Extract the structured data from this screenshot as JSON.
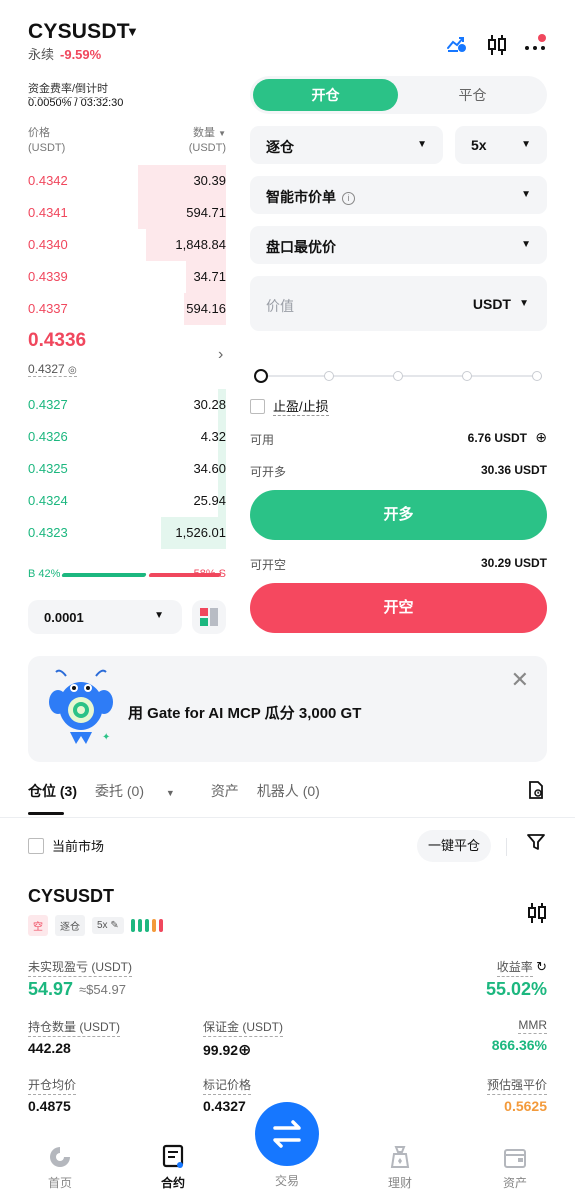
{
  "header": {
    "symbol": "CYSUSDT",
    "perp": "永续",
    "change": "-9.59%",
    "icons": [
      "trend-icon",
      "candlestick-icon",
      "more-icon"
    ]
  },
  "funding": {
    "label": "资金费率/倒计时",
    "value": "0.0050% / 03:32:30"
  },
  "orderbook": {
    "price_header_1": "价格",
    "price_header_2": "(USDT)",
    "qty_header_1": "数量",
    "qty_header_2": "(USDT)",
    "asks": [
      {
        "price": "0.4342",
        "qty": "30.39",
        "depth": 0.45
      },
      {
        "price": "0.4341",
        "qty": "594.71",
        "depth": 0.45
      },
      {
        "price": "0.4340",
        "qty": "1,848.84",
        "depth": 0.41
      },
      {
        "price": "0.4339",
        "qty": "34.71",
        "depth": 0.2
      },
      {
        "price": "0.4337",
        "qty": "594.16",
        "depth": 0.21
      }
    ],
    "last_price": "0.4336",
    "mark_price": "0.4327",
    "bids": [
      {
        "price": "0.4327",
        "qty": "30.28",
        "depth": 0.04
      },
      {
        "price": "0.4326",
        "qty": "4.32",
        "depth": 0.04
      },
      {
        "price": "0.4325",
        "qty": "34.60",
        "depth": 0.04
      },
      {
        "price": "0.4324",
        "qty": "25.94",
        "depth": 0.04
      },
      {
        "price": "0.4323",
        "qty": "1,526.01",
        "depth": 0.33
      }
    ],
    "buy_ratio": "B 42%",
    "sell_ratio": "58% S",
    "precision": "0.0001"
  },
  "order_form": {
    "tab_open": "开仓",
    "tab_close": "平仓",
    "margin_mode": "逐仓",
    "leverage": "5x",
    "order_type": "智能市价单",
    "price_type": "盘口最优价",
    "value_placeholder": "价值",
    "value_unit": "USDT",
    "tpsl_label": "止盈/止损",
    "available_label": "可用",
    "available_value": "6.76  USDT",
    "can_long_label": "可开多",
    "can_long_value": "30.36 USDT",
    "long_button": "开多",
    "can_short_label": "可开空",
    "can_short_value": "30.29 USDT",
    "short_button": "开空",
    "slider_level": 0
  },
  "banner": {
    "text": "用 Gate for AI MCP 瓜分 3,000 GT"
  },
  "positions": {
    "tabs": [
      "仓位 (3)",
      "委托 (0)",
      "资产",
      "机器人 (0)"
    ],
    "current_market": "当前市场",
    "close_all": "一键平仓",
    "symbol": "CYSUSDT",
    "tag_side": "空",
    "tag_mode": "逐仓",
    "tag_lev": "5x",
    "pnl_label": "未实现盈亏 (USDT)",
    "pnl_value": "54.97",
    "pnl_approx": "≈$54.97",
    "roe_label": "收益率",
    "roe_value": "55.02%",
    "size_label": "持仓数量 (USDT)",
    "size_value": "442.28",
    "margin_label": "保证金 (USDT)",
    "margin_value": "99.92",
    "mmr_label": "MMR",
    "mmr_value": "866.36%",
    "entry_label": "开仓均价",
    "entry_value": "0.4875",
    "mark_label": "标记价格",
    "mark_value": "0.4327",
    "liq_label": "预估强平价",
    "liq_value": "0.5625"
  },
  "nav": {
    "home": "首页",
    "futures": "合约",
    "trade": "交易",
    "finance": "理财",
    "assets": "资产"
  },
  "colors": {
    "green": "#2bc287",
    "red": "#f5485f",
    "blue": "#1677ff",
    "orange": "#f39a3b"
  }
}
